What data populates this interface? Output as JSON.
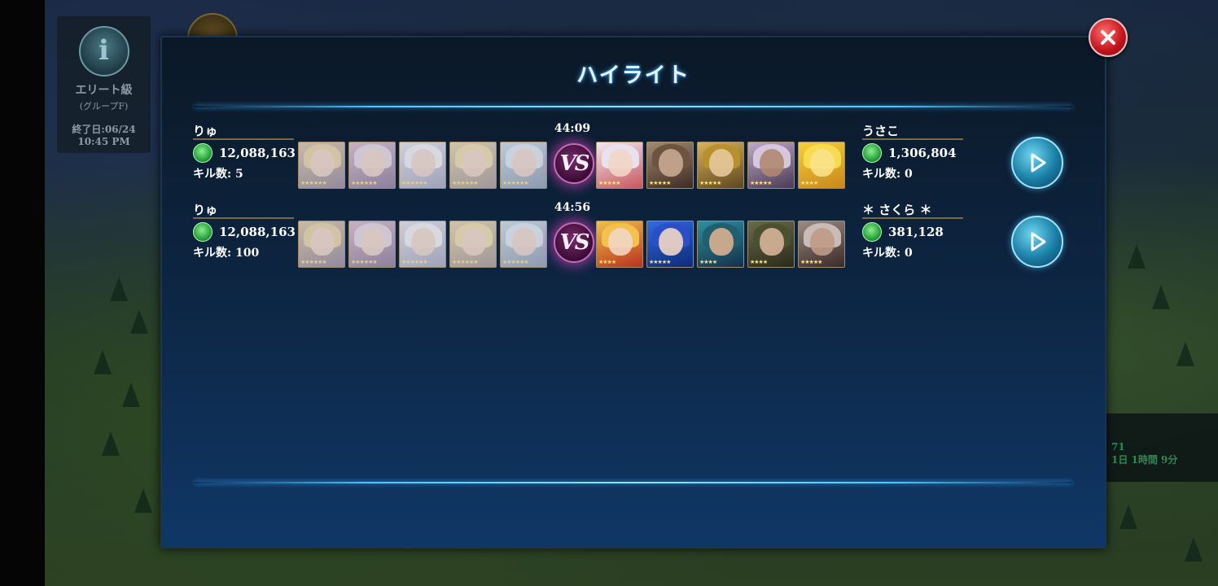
{
  "league": {
    "name": "エリート級",
    "group": "(グループF)",
    "end_label": "終了日:06/24",
    "end_time": "10:45 PM"
  },
  "side_info": {
    "line1": "71",
    "line2": "1日 1時間 9分"
  },
  "dialog": {
    "title": "ハイライト"
  },
  "matches": [
    {
      "time": "44:09",
      "vs_label": "VS",
      "left": {
        "name": "りゅ",
        "power": "12,088,163",
        "kills": "キル数: 5"
      },
      "right": {
        "name": "うさこ",
        "power": "1,306,804",
        "kills": "キル数: 0"
      }
    },
    {
      "time": "44:56",
      "vs_label": "VS",
      "left": {
        "name": "りゅ",
        "power": "12,088,163",
        "kills": "キル数: 100"
      },
      "right": {
        "name": "＊ さくら ＊",
        "power": "381,128",
        "kills": "キル数: 0"
      }
    }
  ],
  "colors": {
    "accent_glow": "#4fc6ff",
    "vs_glow": "#d646be",
    "close_red": "#c1121a",
    "power_green": "#1f9a36"
  },
  "icons": [
    "league-emblem-icon",
    "help-icon",
    "close-icon",
    "power-icon",
    "vs-icon",
    "play-icon",
    "character-card-icon"
  ]
}
